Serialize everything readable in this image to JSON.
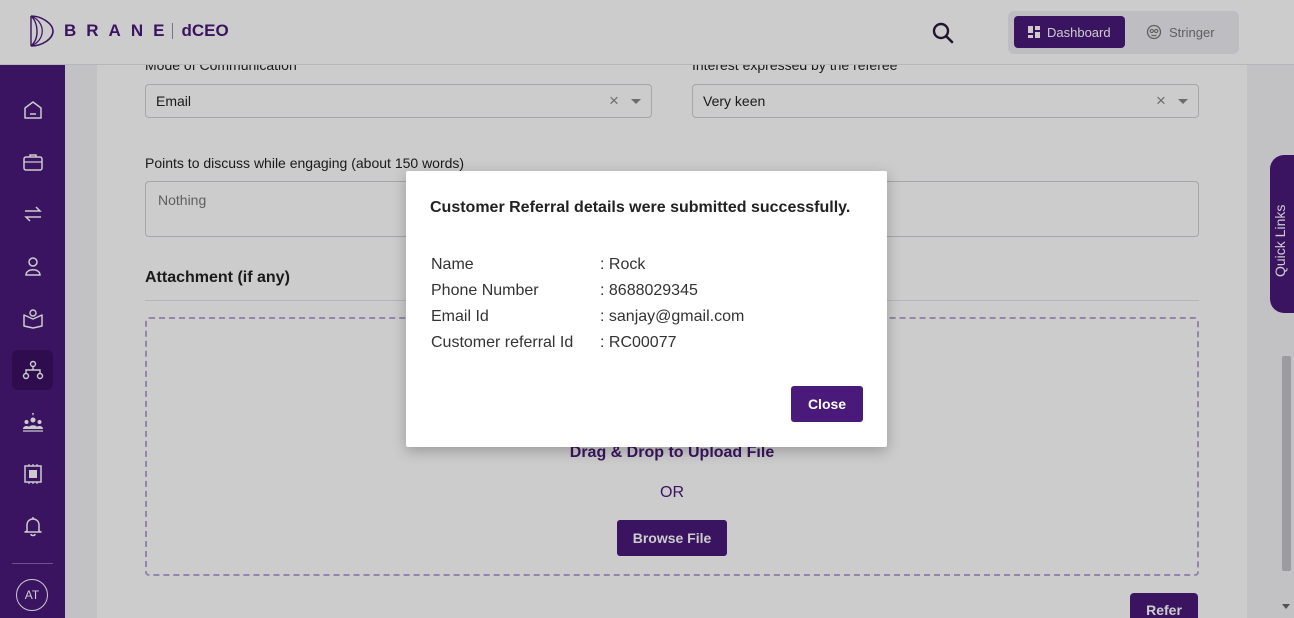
{
  "header": {
    "brand": "BRANE",
    "product": "dCEO",
    "toggle": {
      "dashboard_label": "Dashboard",
      "stringer_label": "Stringer"
    }
  },
  "sidebar": {
    "items": [
      "home-icon",
      "briefcase-icon",
      "transfer-icon",
      "user-icon",
      "book-icon",
      "network-icon",
      "team-icon",
      "chip-icon",
      "bell-icon"
    ],
    "active": "network-icon",
    "avatar_initials": "AT"
  },
  "form": {
    "mode_label": "Mode of Communication",
    "mode_value": "Email",
    "interest_label": "Interest expressed by the referee",
    "interest_value": "Very keen",
    "points_label": "Points to discuss while engaging (about 150 words)",
    "points_value": "Nothing",
    "attachment_title": "Attachment (if any)",
    "drag_drop_text": "Drag & Drop to Upload File",
    "or_text": "OR",
    "browse_label": "Browse File",
    "refer_label": "Refer"
  },
  "quick_links_label": "Quick Links",
  "modal": {
    "title": "Customer Referral details were submitted successfully.",
    "rows": [
      {
        "label": "Name",
        "value": ": Rock"
      },
      {
        "label": "Phone Number",
        "value": ": 8688029345"
      },
      {
        "label": "Email Id",
        "value": ": sanjay@gmail.com"
      },
      {
        "label": "Customer referral Id",
        "value": ": RC00077"
      }
    ],
    "close_label": "Close"
  },
  "colors": {
    "brand": "#4a1a7a",
    "active_nav": "#3a1062"
  }
}
